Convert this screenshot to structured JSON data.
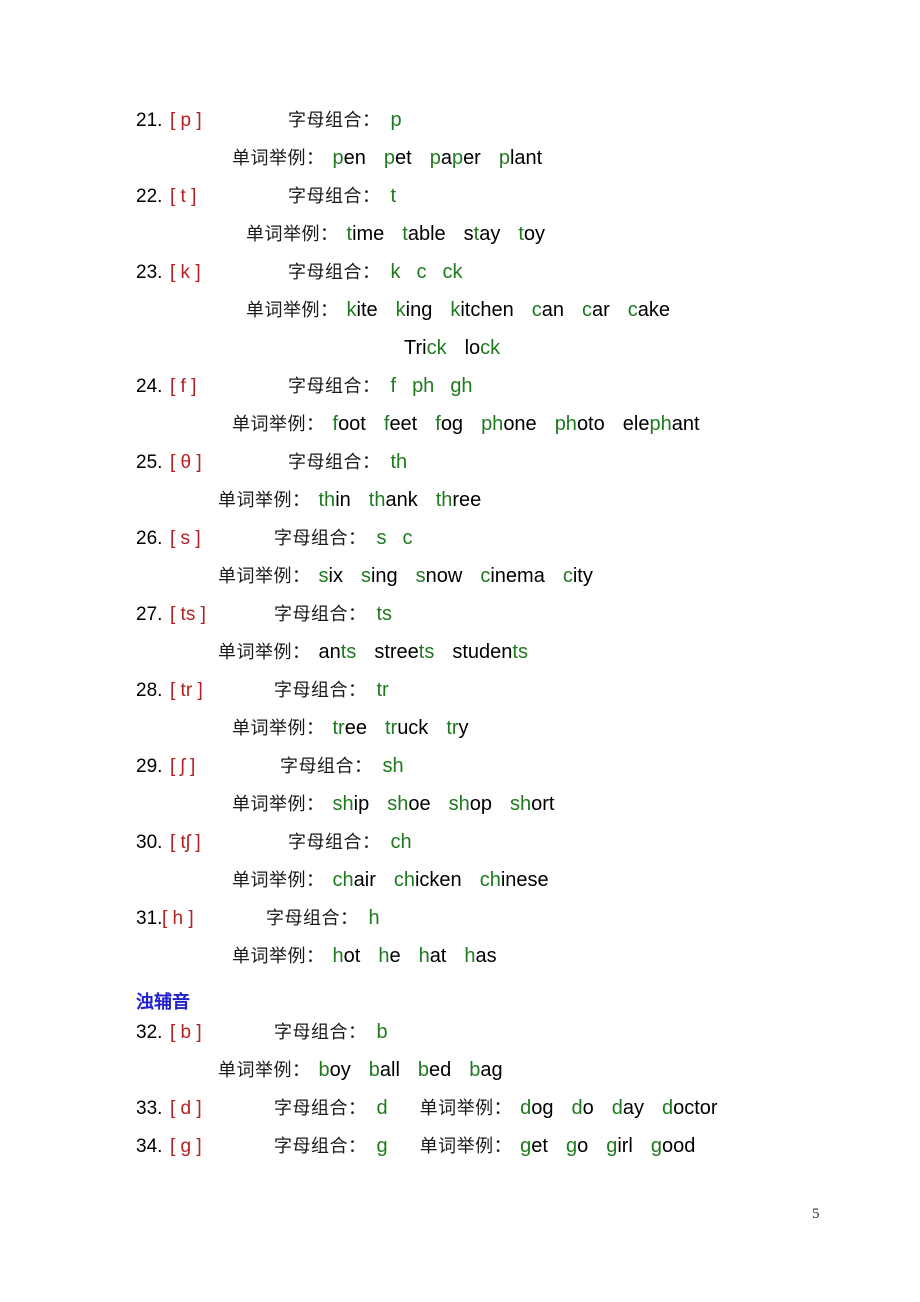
{
  "page": {
    "number": "5",
    "label_letters": "字母组合：",
    "label_words": "单词举例："
  },
  "section_heading": "浊辅音",
  "entries": [
    {
      "index": "21.",
      "ipa": "[ p ]",
      "letters": [
        "p"
      ],
      "words": [
        {
          "text": "pen",
          "green": "p"
        },
        {
          "text": "pet",
          "green": "p"
        },
        {
          "text": "paper",
          "green_parts": [
            [
              0,
              1
            ],
            [
              2,
              3
            ]
          ]
        },
        {
          "text": "plant",
          "green": "p"
        }
      ]
    },
    {
      "index": "22.",
      "ipa": "[ t ]",
      "letters": [
        "t"
      ],
      "words": [
        {
          "text": "time",
          "green_parts": [
            [
              0,
              1
            ]
          ]
        },
        {
          "text": "table",
          "green_parts": [
            [
              0,
              1
            ]
          ]
        },
        {
          "text": "stay",
          "green_parts": [
            [
              1,
              2
            ]
          ]
        },
        {
          "text": "toy",
          "green_parts": [
            [
              0,
              1
            ]
          ]
        }
      ]
    },
    {
      "index": "23.",
      "ipa": "[ k ]",
      "letters": [
        "k",
        "c",
        "ck"
      ],
      "words": [
        {
          "text": "kite",
          "green_parts": [
            [
              0,
              1
            ]
          ]
        },
        {
          "text": "king",
          "green_parts": [
            [
              0,
              1
            ]
          ]
        },
        {
          "text": "kitchen",
          "green_parts": [
            [
              0,
              1
            ]
          ]
        },
        {
          "text": "can",
          "green_parts": [
            [
              0,
              1
            ]
          ]
        },
        {
          "text": "car",
          "green_parts": [
            [
              0,
              1
            ]
          ]
        },
        {
          "text": "cake",
          "green_parts": [
            [
              0,
              1
            ]
          ]
        }
      ],
      "words2": [
        {
          "text": "Trick",
          "green_parts": [
            [
              3,
              5
            ]
          ]
        },
        {
          "text": "lock",
          "green_parts": [
            [
              2,
              4
            ]
          ]
        }
      ]
    },
    {
      "index": "24.",
      "ipa": "[ f ]",
      "letters": [
        "f",
        "ph",
        "gh"
      ],
      "words": [
        {
          "text": "foot",
          "green_parts": [
            [
              0,
              1
            ]
          ]
        },
        {
          "text": "feet",
          "green_parts": [
            [
              0,
              1
            ]
          ]
        },
        {
          "text": "fog",
          "green_parts": [
            [
              0,
              1
            ]
          ]
        },
        {
          "text": "phone",
          "green_parts": [
            [
              0,
              2
            ]
          ]
        },
        {
          "text": "photo",
          "green_parts": [
            [
              0,
              2
            ]
          ]
        },
        {
          "text": "elephant",
          "green_parts": [
            [
              3,
              5
            ]
          ]
        }
      ]
    },
    {
      "index": "25.",
      "ipa": "[ θ ]",
      "letters": [
        "th"
      ],
      "words": [
        {
          "text": "thin",
          "green_parts": [
            [
              0,
              2
            ]
          ]
        },
        {
          "text": "thank",
          "green_parts": [
            [
              0,
              2
            ]
          ]
        },
        {
          "text": "three",
          "green_parts": [
            [
              0,
              2
            ]
          ]
        }
      ]
    },
    {
      "index": "26.",
      "ipa": "[ s ]",
      "letters": [
        "s",
        "c"
      ],
      "words": [
        {
          "text": "six",
          "green_parts": [
            [
              0,
              1
            ]
          ]
        },
        {
          "text": "sing",
          "green_parts": [
            [
              0,
              1
            ]
          ]
        },
        {
          "text": "snow",
          "green_parts": [
            [
              0,
              1
            ]
          ]
        },
        {
          "text": "cinema",
          "green_parts": [
            [
              0,
              1
            ]
          ]
        },
        {
          "text": "city",
          "green_parts": [
            [
              0,
              1
            ]
          ]
        }
      ]
    },
    {
      "index": "27.",
      "ipa": "[ ts ]",
      "letters": [
        "ts"
      ],
      "words": [
        {
          "text": "ants",
          "green_parts": [
            [
              2,
              4
            ]
          ]
        },
        {
          "text": "streets",
          "green_parts": [
            [
              5,
              7
            ]
          ]
        },
        {
          "text": "students",
          "green_parts": [
            [
              6,
              8
            ]
          ]
        }
      ]
    },
    {
      "index": "28.",
      "ipa": "[ tr ]",
      "letters": [
        "tr"
      ],
      "words": [
        {
          "text": "tree",
          "green_parts": [
            [
              0,
              2
            ]
          ]
        },
        {
          "text": "truck",
          "green_parts": [
            [
              0,
              2
            ]
          ]
        },
        {
          "text": "try",
          "green_parts": [
            [
              0,
              2
            ]
          ]
        }
      ]
    },
    {
      "index": "29.",
      "ipa": "[ ʃ ]",
      "letters": [
        "sh"
      ],
      "words": [
        {
          "text": "ship",
          "green_parts": [
            [
              0,
              2
            ]
          ]
        },
        {
          "text": "shoe",
          "green_parts": [
            [
              0,
              2
            ]
          ]
        },
        {
          "text": "shop",
          "green_parts": [
            [
              0,
              2
            ]
          ]
        },
        {
          "text": "short",
          "green_parts": [
            [
              0,
              2
            ]
          ]
        }
      ]
    },
    {
      "index": "30.",
      "ipa": "[ tʃ ]",
      "letters": [
        "ch"
      ],
      "words": [
        {
          "text": "chair",
          "green_parts": [
            [
              0,
              2
            ]
          ]
        },
        {
          "text": "chicken",
          "green_parts": [
            [
              0,
              2
            ]
          ]
        },
        {
          "text": "chinese",
          "green_parts": [
            [
              0,
              2
            ]
          ]
        }
      ]
    },
    {
      "index": "31.",
      "ipa": "[ h ]",
      "letters": [
        "h"
      ],
      "words": [
        {
          "text": "hot",
          "green_parts": [
            [
              0,
              1
            ]
          ]
        },
        {
          "text": "he",
          "green_parts": [
            [
              0,
              1
            ]
          ]
        },
        {
          "text": "hat",
          "green_parts": [
            [
              0,
              1
            ]
          ]
        },
        {
          "text": "has",
          "green_parts": [
            [
              0,
              1
            ]
          ]
        }
      ]
    },
    {
      "index": "32.",
      "ipa": "[ b ]",
      "letters": [
        "b"
      ],
      "words": [
        {
          "text": "boy",
          "green_parts": [
            [
              0,
              1
            ]
          ]
        },
        {
          "text": "ball",
          "green_parts": [
            [
              0,
              1
            ]
          ]
        },
        {
          "text": "bed",
          "green_parts": [
            [
              0,
              1
            ]
          ]
        },
        {
          "text": "bag",
          "green_parts": [
            [
              0,
              1
            ]
          ]
        }
      ]
    },
    {
      "index": "33.",
      "ipa": "[ d ]",
      "letters": [
        "d"
      ],
      "inline": true,
      "words": [
        {
          "text": "dog",
          "green_parts": [
            [
              0,
              1
            ]
          ]
        },
        {
          "text": "do",
          "green_parts": [
            [
              0,
              1
            ]
          ]
        },
        {
          "text": "day",
          "green_parts": [
            [
              0,
              1
            ]
          ]
        },
        {
          "text": "doctor",
          "green_parts": [
            [
              0,
              1
            ]
          ]
        }
      ]
    },
    {
      "index": "34.",
      "ipa": "[ g ]",
      "letters": [
        "g"
      ],
      "inline": true,
      "words": [
        {
          "text": "get",
          "green_parts": [
            [
              0,
              1
            ]
          ]
        },
        {
          "text": "go",
          "green_parts": [
            [
              0,
              1
            ]
          ]
        },
        {
          "text": "girl",
          "green_parts": [
            [
              0,
              1
            ]
          ]
        },
        {
          "text": "good",
          "green_parts": [
            [
              0,
              1
            ]
          ]
        }
      ]
    }
  ],
  "colors": {
    "ipa": "#b52020",
    "green": "#1f7a1f",
    "black": "#000000",
    "heading_blue": "#2222cc"
  }
}
